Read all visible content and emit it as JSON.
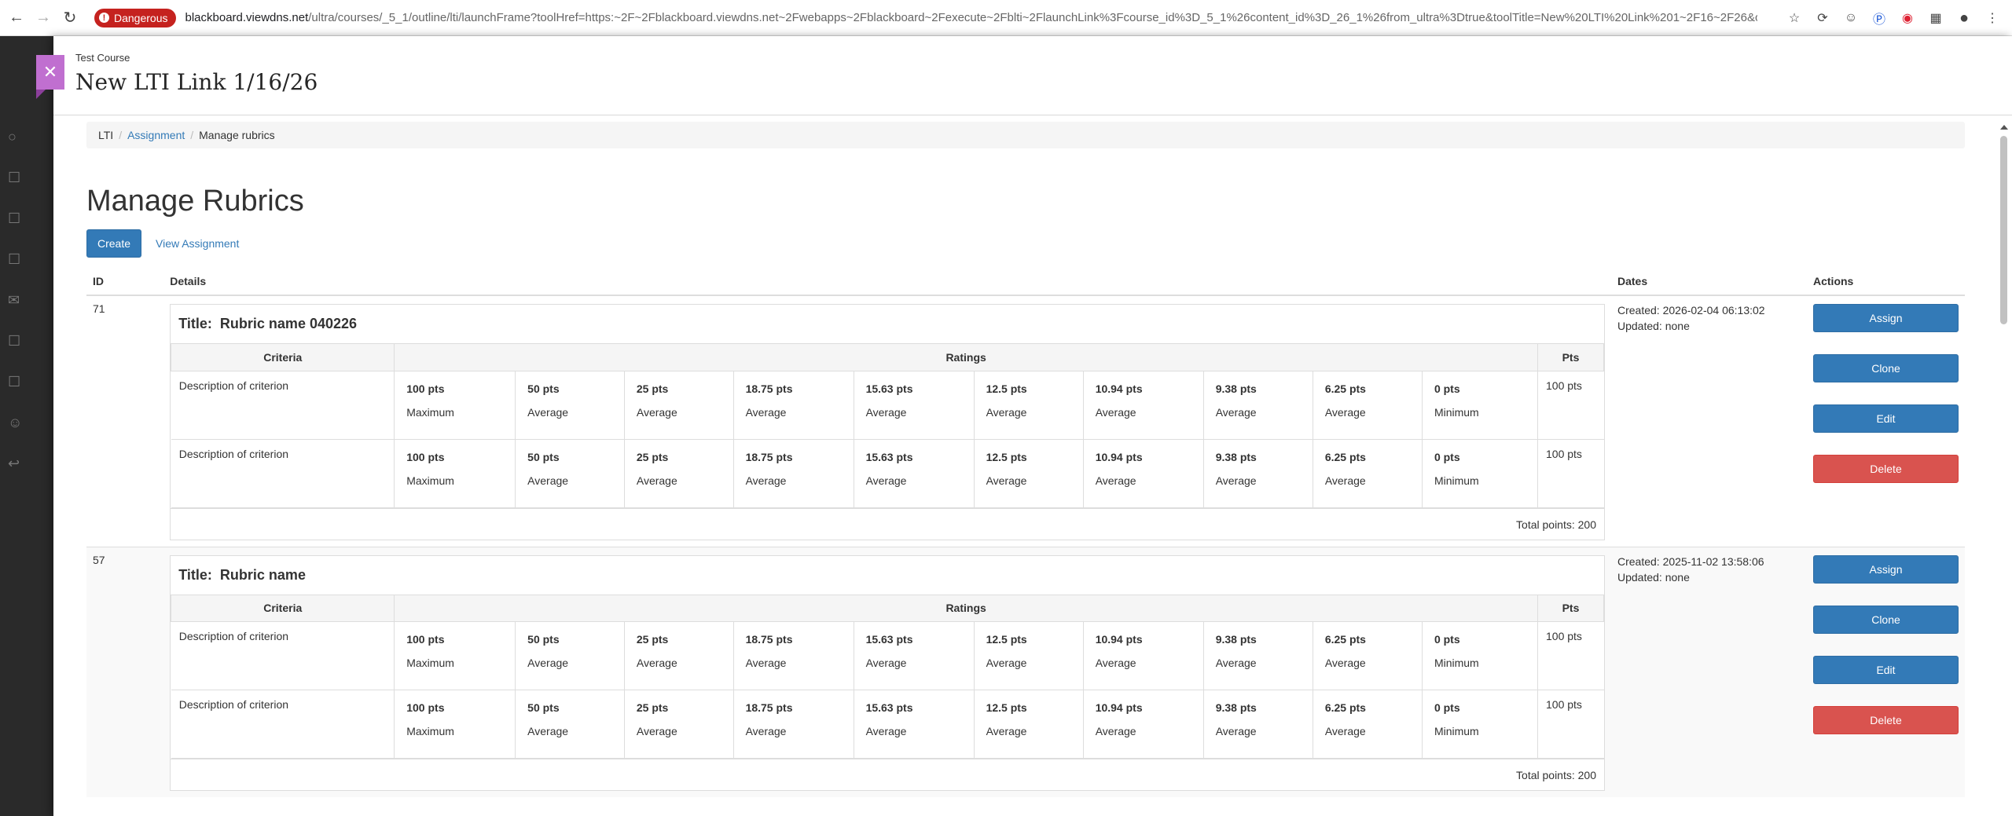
{
  "browser": {
    "security_chip": "Dangerous",
    "url_host": "blackboard.viewdns.net",
    "url_path": "/ultra/courses/_5_1/outline/lti/launchFrame?toolHref=https:~2F~2Fblackboard.viewdns.net~2Fwebapps~2Fblackboard~2Fexecute~2Fblti~2FlaunchLink%3Fcourse_id%3D_5_1%26content_id%3D_26_1%26from_ultra%3Dtrue&toolTitle=New%20LTI%20Link%201~2F16~2F26&con..."
  },
  "panel": {
    "course_name": "Test Course",
    "title": "New LTI Link 1/16/26"
  },
  "breadcrumb": {
    "item1": "LTI",
    "item2": "Assignment",
    "item3": "Manage rubrics"
  },
  "page": {
    "heading": "Manage Rubrics",
    "create_label": "Create",
    "view_assignment_label": "View Assignment"
  },
  "table": {
    "headers": {
      "id": "ID",
      "details": "Details",
      "dates": "Dates",
      "actions": "Actions"
    },
    "rubric_headers": {
      "criteria": "Criteria",
      "ratings": "Ratings",
      "pts": "Pts"
    },
    "title_prefix": "Title:",
    "actions": {
      "assign": "Assign",
      "clone": "Clone",
      "edit": "Edit",
      "delete": "Delete"
    }
  },
  "rubrics": [
    {
      "id": "71",
      "title": "Rubric name 040226",
      "created": "Created: 2026-02-04 06:13:02",
      "updated": "Updated: none",
      "total": "Total points: 200",
      "criteria": [
        {
          "description": "Description of criterion",
          "points": "100 pts",
          "ratings": [
            {
              "pts": "100 pts",
              "label": "Maximum"
            },
            {
              "pts": "50 pts",
              "label": "Average"
            },
            {
              "pts": "25 pts",
              "label": "Average"
            },
            {
              "pts": "18.75 pts",
              "label": "Average"
            },
            {
              "pts": "15.63 pts",
              "label": "Average"
            },
            {
              "pts": "12.5 pts",
              "label": "Average"
            },
            {
              "pts": "10.94 pts",
              "label": "Average"
            },
            {
              "pts": "9.38 pts",
              "label": "Average"
            },
            {
              "pts": "6.25 pts",
              "label": "Average"
            },
            {
              "pts": "0 pts",
              "label": "Minimum"
            }
          ]
        },
        {
          "description": "Description of criterion",
          "points": "100 pts",
          "ratings": [
            {
              "pts": "100 pts",
              "label": "Maximum"
            },
            {
              "pts": "50 pts",
              "label": "Average"
            },
            {
              "pts": "25 pts",
              "label": "Average"
            },
            {
              "pts": "18.75 pts",
              "label": "Average"
            },
            {
              "pts": "15.63 pts",
              "label": "Average"
            },
            {
              "pts": "12.5 pts",
              "label": "Average"
            },
            {
              "pts": "10.94 pts",
              "label": "Average"
            },
            {
              "pts": "9.38 pts",
              "label": "Average"
            },
            {
              "pts": "6.25 pts",
              "label": "Average"
            },
            {
              "pts": "0 pts",
              "label": "Minimum"
            }
          ]
        }
      ]
    },
    {
      "id": "57",
      "title": "Rubric name",
      "created": "Created: 2025-11-02 13:58:06",
      "updated": "Updated: none",
      "total": "Total points: 200",
      "criteria": [
        {
          "description": "Description of criterion",
          "points": "100 pts",
          "ratings": [
            {
              "pts": "100 pts",
              "label": "Maximum"
            },
            {
              "pts": "50 pts",
              "label": "Average"
            },
            {
              "pts": "25 pts",
              "label": "Average"
            },
            {
              "pts": "18.75 pts",
              "label": "Average"
            },
            {
              "pts": "15.63 pts",
              "label": "Average"
            },
            {
              "pts": "12.5 pts",
              "label": "Average"
            },
            {
              "pts": "10.94 pts",
              "label": "Average"
            },
            {
              "pts": "9.38 pts",
              "label": "Average"
            },
            {
              "pts": "6.25 pts",
              "label": "Average"
            },
            {
              "pts": "0 pts",
              "label": "Minimum"
            }
          ]
        },
        {
          "description": "Description of criterion",
          "points": "100 pts",
          "ratings": [
            {
              "pts": "100 pts",
              "label": "Maximum"
            },
            {
              "pts": "50 pts",
              "label": "Average"
            },
            {
              "pts": "25 pts",
              "label": "Average"
            },
            {
              "pts": "18.75 pts",
              "label": "Average"
            },
            {
              "pts": "15.63 pts",
              "label": "Average"
            },
            {
              "pts": "12.5 pts",
              "label": "Average"
            },
            {
              "pts": "10.94 pts",
              "label": "Average"
            },
            {
              "pts": "9.38 pts",
              "label": "Average"
            },
            {
              "pts": "6.25 pts",
              "label": "Average"
            },
            {
              "pts": "0 pts",
              "label": "Minimum"
            }
          ]
        }
      ]
    }
  ],
  "colors": {
    "primary": "#337ab7",
    "danger": "#d9534f",
    "security_chip": "#c5221f",
    "close_tab": "#c06fd0"
  }
}
